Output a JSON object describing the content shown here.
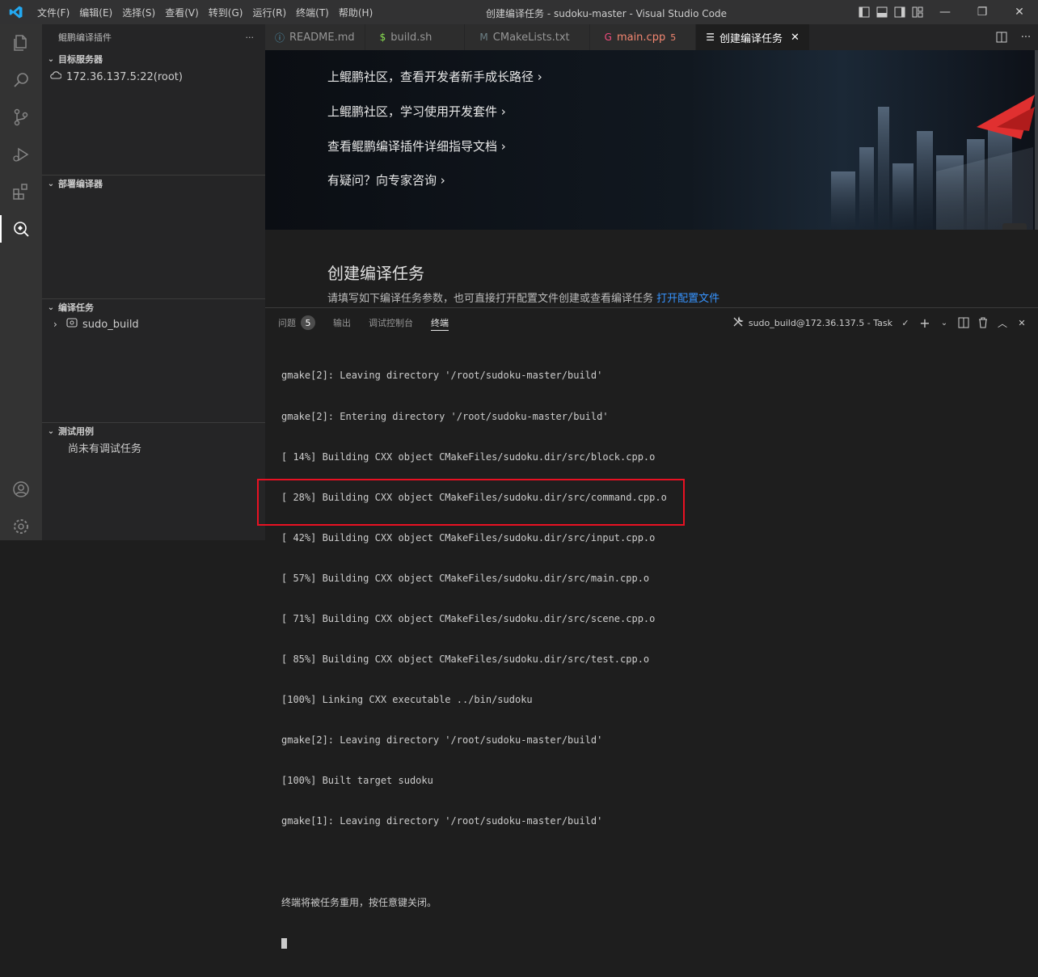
{
  "titlebar": {
    "menu": [
      "文件(F)",
      "编辑(E)",
      "选择(S)",
      "查看(V)",
      "转到(G)",
      "运行(R)",
      "终端(T)",
      "帮助(H)"
    ],
    "window_title": "创建编译任务 - sudoku-master - Visual Studio Code"
  },
  "sidebar": {
    "title": "鲲鹏编译插件",
    "more": "···",
    "sections": {
      "target_server": {
        "title": "目标服务器",
        "items": [
          "172.36.137.5:22(root)"
        ]
      },
      "deploy_compiler": {
        "title": "部署编译器"
      },
      "compile_tasks": {
        "title": "编译任务",
        "items": [
          "sudo_build"
        ]
      },
      "test_cases": {
        "title": "测试用例",
        "empty": "尚未有调试任务"
      }
    }
  },
  "tabs": [
    {
      "label": "README.md",
      "icon": "info-icon",
      "active": false
    },
    {
      "label": "build.sh",
      "icon": "dollar-icon",
      "active": false
    },
    {
      "label": "CMakeLists.txt",
      "icon": "cmake-icon",
      "active": false
    },
    {
      "label": "main.cpp",
      "badge": "5",
      "icon": "cpp-icon",
      "active": false
    },
    {
      "label": "创建编译任务",
      "icon": "preview-icon",
      "active": true
    }
  ],
  "editor": {
    "links": [
      "上鲲鹏社区，查看开发者新手成长路径 ›",
      "上鲲鹏社区，学习使用开发套件 ›",
      "查看鲲鹏编译插件详细指导文档 ›",
      "有疑问？向专家咨询 ›"
    ],
    "section_title": "创建编译任务",
    "section_desc": "请填写如下编译任务参数，也可直接打开配置文件创建或查看编译任务",
    "open_config_link": "打开配置文件"
  },
  "panel": {
    "tabs": [
      {
        "label": "问题",
        "badge": "5",
        "active": false
      },
      {
        "label": "输出",
        "active": false
      },
      {
        "label": "调试控制台",
        "active": false
      },
      {
        "label": "终端",
        "active": true
      }
    ],
    "task_label": "sudo_build@172.36.137.5 - Task",
    "terminal_lines": [
      "gmake[2]: Leaving directory '/root/sudoku-master/build'",
      "gmake[2]: Entering directory '/root/sudoku-master/build'",
      "[ 14%] Building CXX object CMakeFiles/sudoku.dir/src/block.cpp.o",
      "[ 28%] Building CXX object CMakeFiles/sudoku.dir/src/command.cpp.o",
      "[ 42%] Building CXX object CMakeFiles/sudoku.dir/src/input.cpp.o",
      "[ 57%] Building CXX object CMakeFiles/sudoku.dir/src/main.cpp.o",
      "[ 71%] Building CXX object CMakeFiles/sudoku.dir/src/scene.cpp.o",
      "[ 85%] Building CXX object CMakeFiles/sudoku.dir/src/test.cpp.o",
      "[100%] Linking CXX executable ../bin/sudoku",
      "gmake[2]: Leaving directory '/root/sudoku-master/build'",
      "[100%] Built target sudoku",
      "gmake[1]: Leaving directory '/root/sudoku-master/build'",
      "",
      "终端将被任务重用，按任意键关闭。"
    ]
  },
  "colors": {
    "accent_link": "#3794ff",
    "highlight": "#e81123",
    "vscode_blue": "#23a9f2"
  }
}
